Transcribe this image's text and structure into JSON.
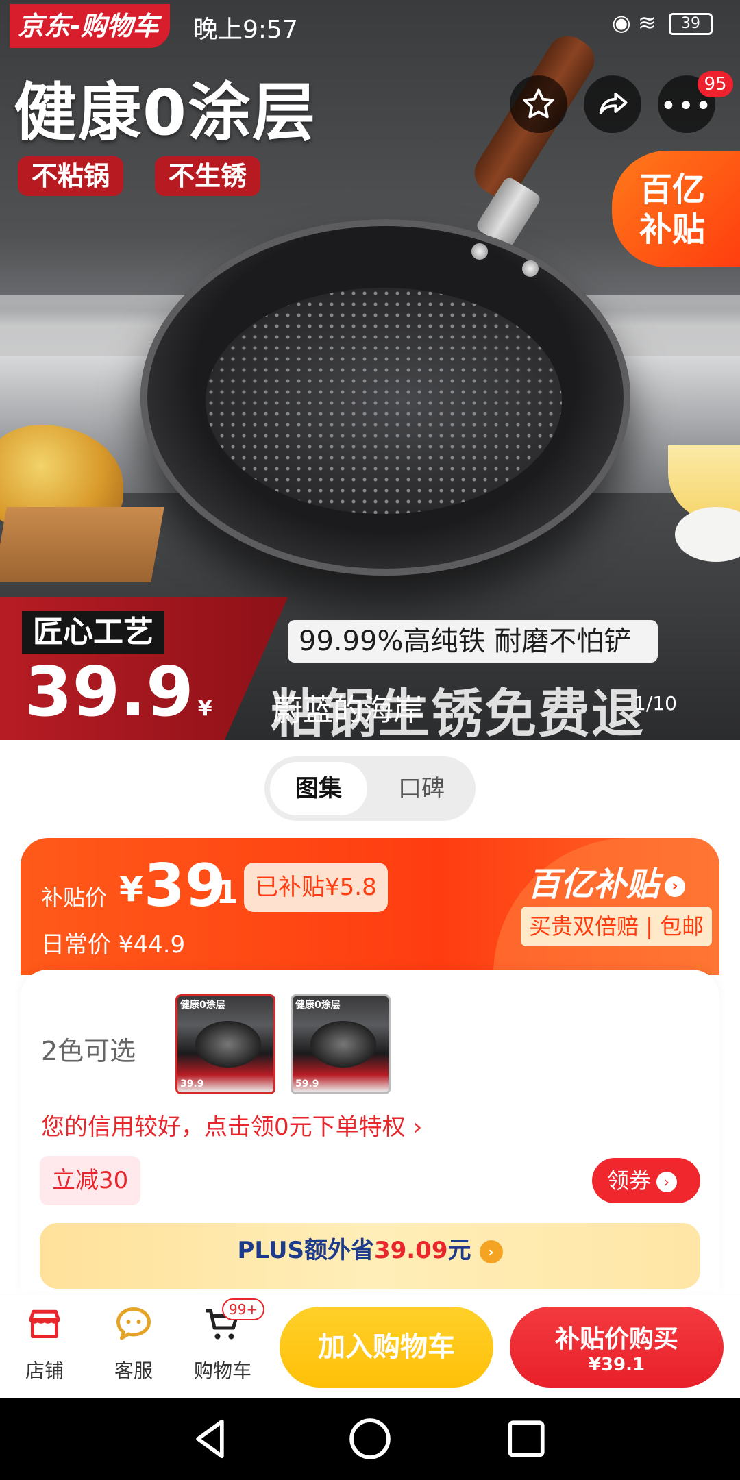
{
  "status_bar": {
    "app_label": "京东-购物车",
    "time": "晚上9:57",
    "battery": "39"
  },
  "hero": {
    "title": "健康0涂层",
    "tags": [
      "不粘锅",
      "不生锈"
    ],
    "subsidy_badge": [
      "百亿",
      "补贴"
    ],
    "craft_label": "匠心工艺",
    "price": "39.9",
    "price_unit": "¥",
    "feature": "99.99%高纯铁 耐磨不怕铲",
    "guarantee": "粘锅生锈免费退",
    "watermark": "蔚蓝的海岸",
    "page_indicator": "1/10",
    "cart_count_badge": "95",
    "icons": [
      "back-arrow-icon",
      "star-icon",
      "share-icon",
      "more-icon"
    ]
  },
  "tabs": [
    {
      "label": "图集",
      "active": true
    },
    {
      "label": "口碑",
      "active": false
    }
  ],
  "price_panel": {
    "subsidy_label": "补贴价",
    "currency": "¥",
    "price_int": "39",
    "price_dec": ".1",
    "subsidized": "已补贴¥5.8",
    "daily_price": "日常价 ¥44.9",
    "brand": "百亿补贴",
    "promise": "买贵双倍赔 | 包邮"
  },
  "options": {
    "colors_label": "2色可选",
    "thumbnails": [
      {
        "title": "健康0涂层",
        "price": "39.9"
      },
      {
        "title": "健康0涂层",
        "price": "59.9"
      }
    ],
    "credit_text": "您的信用较好，点击领0元下单特权 ›",
    "coupon_tag": "立减30",
    "coupon_button": "领券",
    "plus_prefix": "PLUS额外省",
    "plus_amount": "39.09",
    "plus_suffix": "元"
  },
  "action_bar": {
    "shop": "店铺",
    "service": "客服",
    "cart": "购物车",
    "cart_badge": "99+",
    "add_to_cart": "加入购物车",
    "buy_title": "补贴价购买",
    "buy_price": "¥39.1"
  },
  "colors": {
    "brand_red": "#e8262c",
    "subsidy_orange": "#ff3c10",
    "add_cart_yellow": "#ffc008",
    "plus_blue": "#1e3a8a"
  }
}
